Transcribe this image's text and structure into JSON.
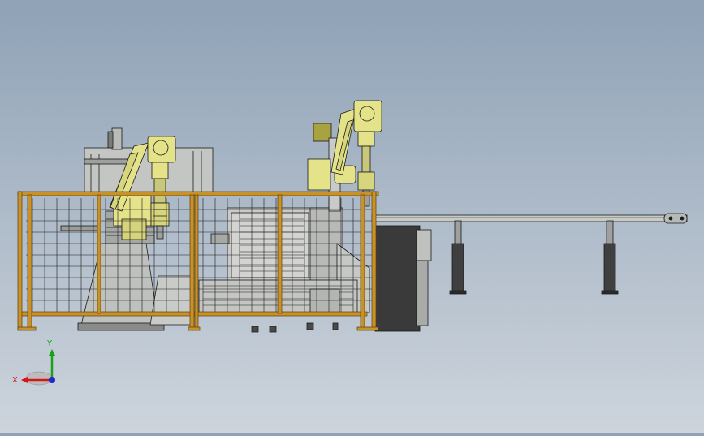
{
  "viewport": {
    "background_top": "#8fa2b6",
    "background_bottom": "#cdd4dc"
  },
  "colors": {
    "frame_orange": "#c8922a",
    "robot_yellow": "#e5e38a",
    "line_dark": "#1b1b1b",
    "machine_gray": "#c7c9c6",
    "cabinet_dark": "#3a3a3a"
  },
  "triad": {
    "x_label": "X",
    "y_label": "Y",
    "x_color": "#d01818",
    "y_color": "#1aa01a",
    "z_color": "#1a2ad0"
  }
}
